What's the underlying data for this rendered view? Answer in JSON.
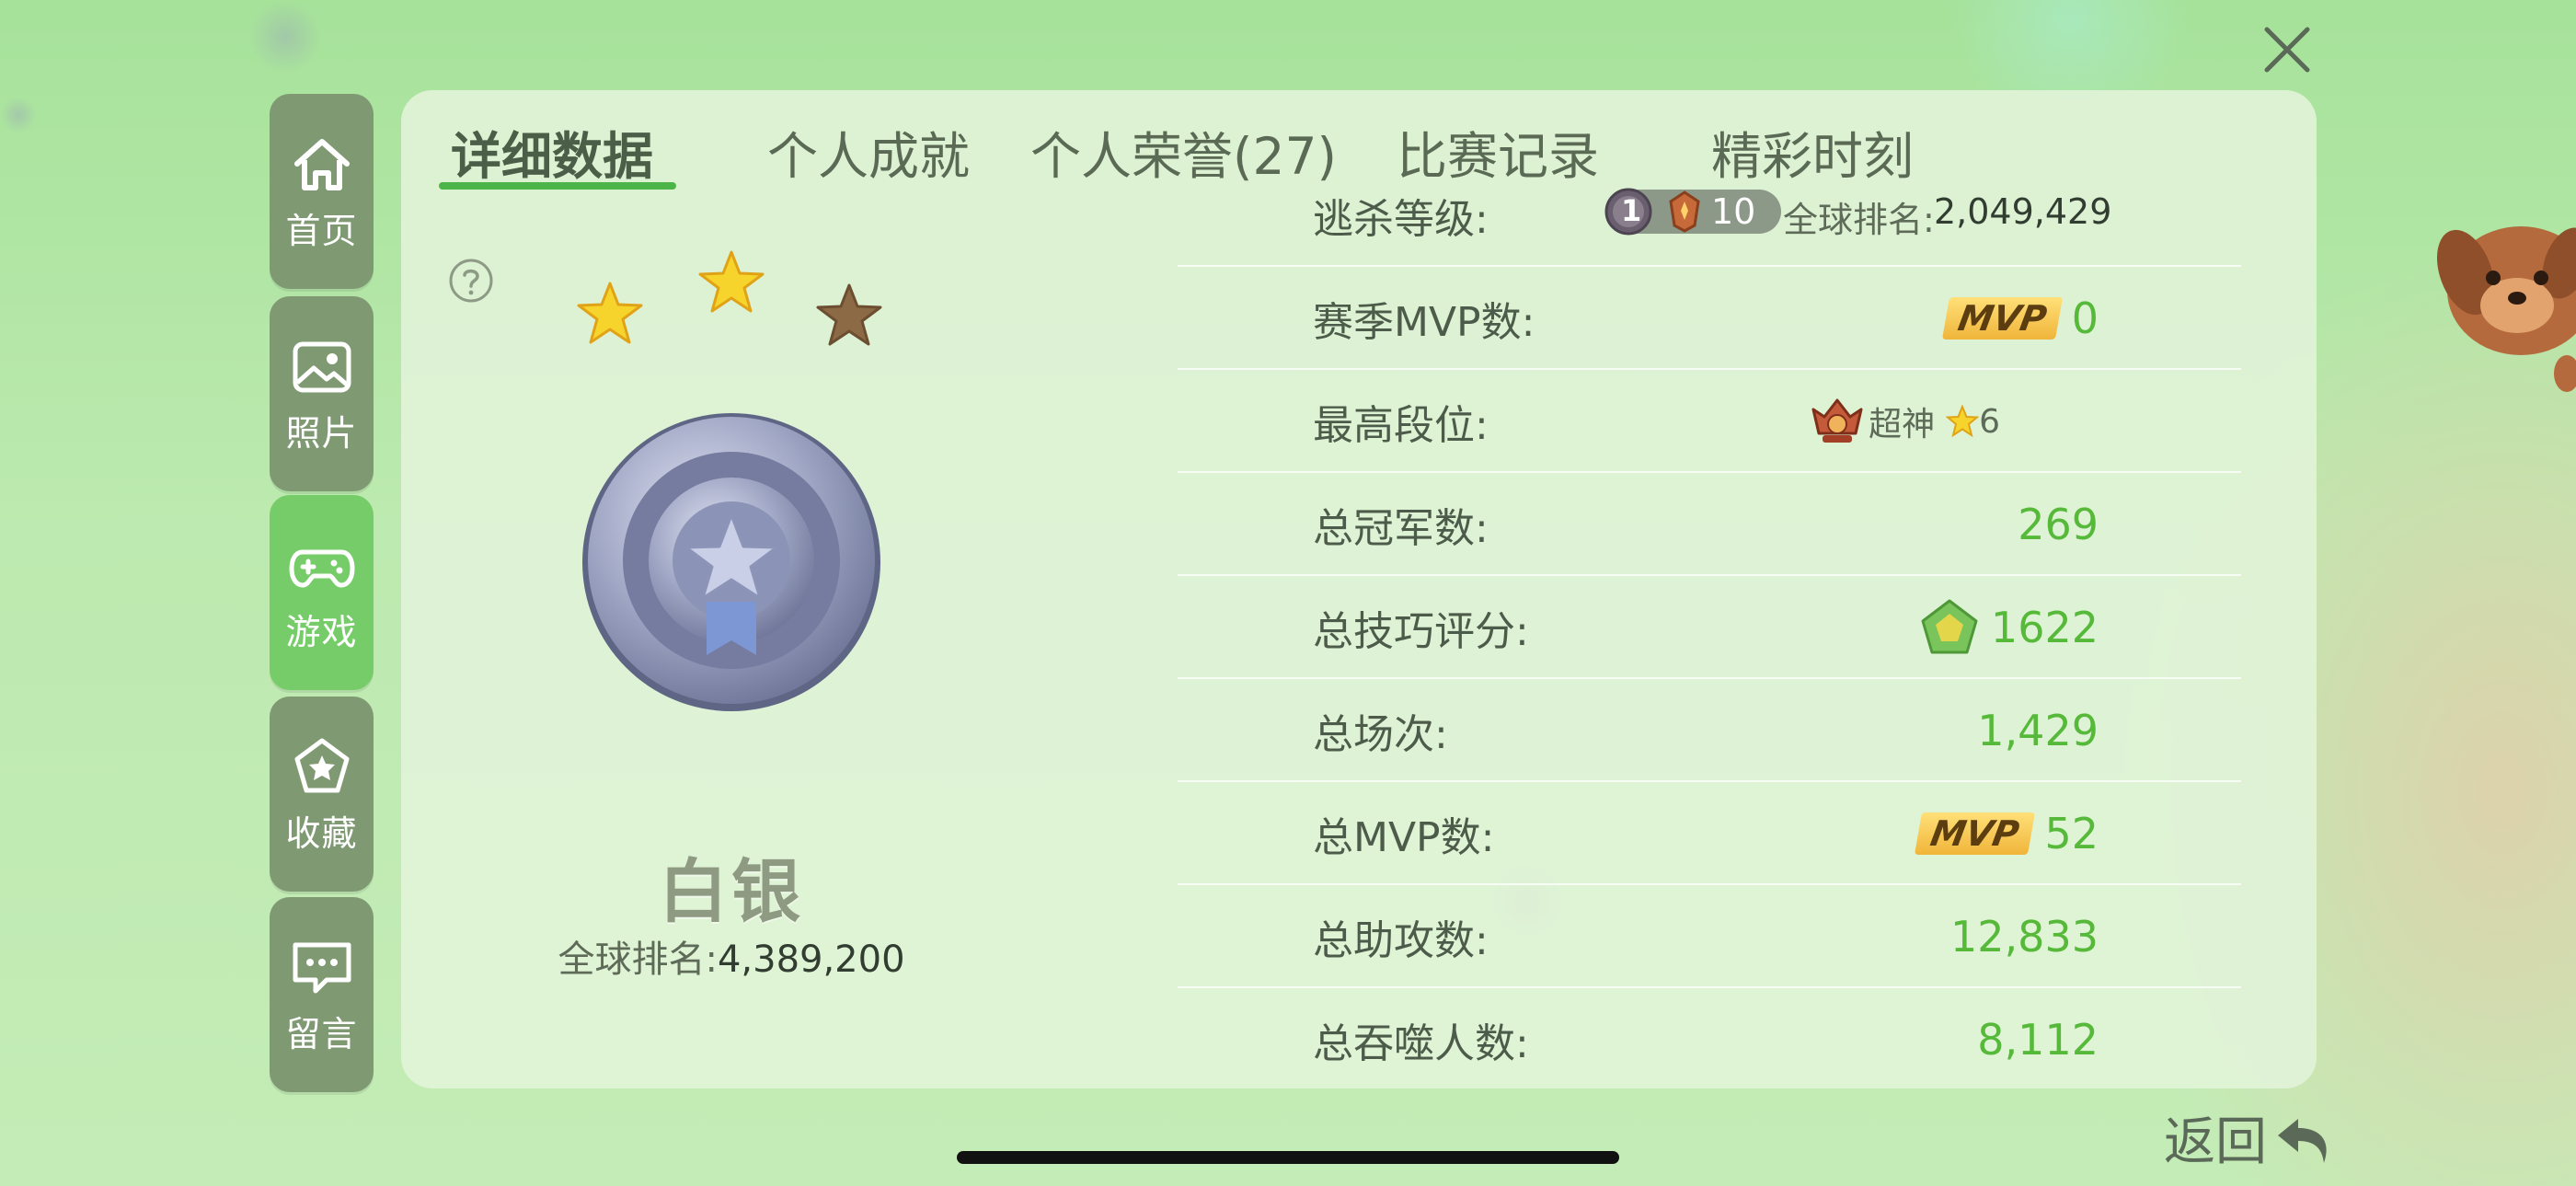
{
  "sidebar": {
    "items": [
      {
        "label": "首页",
        "icon": "home-icon"
      },
      {
        "label": "照片",
        "icon": "photo-icon"
      },
      {
        "label": "游戏",
        "icon": "gamepad-icon",
        "active": true
      },
      {
        "label": "收藏",
        "icon": "star-bookmark-icon"
      },
      {
        "label": "留言",
        "icon": "message-icon"
      }
    ]
  },
  "tabs": [
    {
      "label": "详细数据",
      "active": true
    },
    {
      "label": "个人成就"
    },
    {
      "label": "个人荣誉(27)"
    },
    {
      "label": "比赛记录"
    },
    {
      "label": "精彩时刻"
    }
  ],
  "rank": {
    "title": "白银",
    "global_label": "全球排名:",
    "global_value": "4,389,200",
    "stars_filled": 2,
    "stars_total": 3
  },
  "stats": {
    "escape_level": {
      "label": "逃杀等级:",
      "level_badge": "1",
      "level_value": "10",
      "global_label": "全球排名:",
      "global_value": "2,049,429"
    },
    "season_mvp": {
      "label": "赛季MVP数:",
      "badge": "MVP",
      "value": "0"
    },
    "highest_tier": {
      "label": "最高段位:",
      "tier_name": "超神",
      "tier_stars": "6"
    },
    "total_champions": {
      "label": "总冠军数:",
      "value": "269"
    },
    "total_skill": {
      "label": "总技巧评分:",
      "value": "1622"
    },
    "total_matches": {
      "label": "总场次:",
      "value": "1,429"
    },
    "total_mvp": {
      "label": "总MVP数:",
      "badge": "MVP",
      "value": "52"
    },
    "total_assists": {
      "label": "总助攻数:",
      "value": "12,833"
    },
    "total_devoured": {
      "label": "总吞噬人数:",
      "value": "8,112"
    }
  },
  "footer": {
    "back_label": "返回"
  },
  "colors": {
    "accent_green": "#56b93a",
    "sidebar_bg": "#7f9a72",
    "sidebar_active": "#76cc68",
    "tab_underline": "#4cb54a"
  }
}
